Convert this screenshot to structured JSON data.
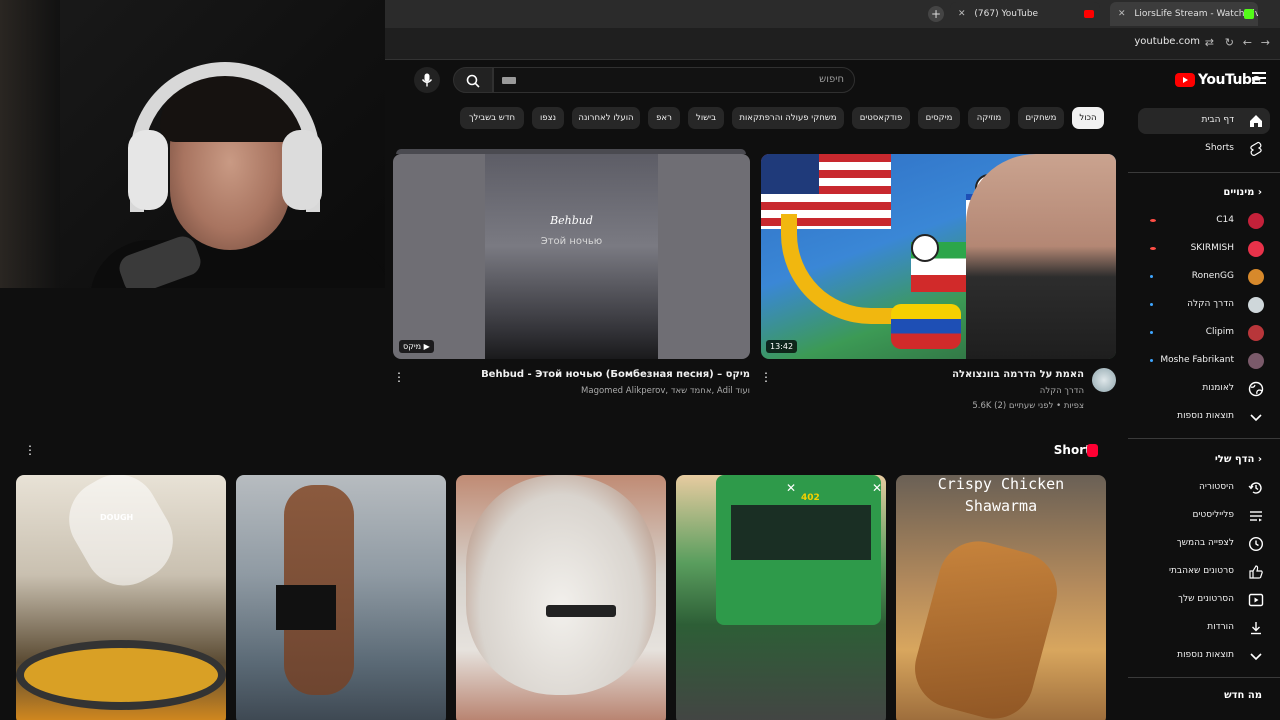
{
  "browser": {
    "tabs": [
      {
        "label": "(767) YouTube"
      },
      {
        "label": "LiorsLife Stream - Watch Live on Kick"
      }
    ],
    "url": "youtube.com"
  },
  "header": {
    "logo_text": "YouTube",
    "search_placeholder": "חיפוש"
  },
  "chips": [
    "הכול",
    "משחקים",
    "מוזיקה",
    "מיקסים",
    "פודקאסטים",
    "משחקי פעולה והרפתקאות",
    "בישול",
    "ראפ",
    "הועלו לאחרונה",
    "נצפו",
    "חדש בשבילך"
  ],
  "sidebar": {
    "home": "דף הבית",
    "shorts": "Shorts",
    "subs_header": "מינויים",
    "subs": [
      {
        "name": "C14",
        "status": "live"
      },
      {
        "name": "SKIRMISH",
        "status": "live"
      },
      {
        "name": "RonenGG",
        "status": "new"
      },
      {
        "name": "הדרך הקלה",
        "status": "new"
      },
      {
        "name": "Clipim",
        "status": "new"
      },
      {
        "name": "Moshe Fabrikant",
        "status": "new"
      },
      {
        "name": "לאומנות",
        "status": "none"
      }
    ],
    "more1": "תוצאות נוספות",
    "you_header": "הדף שלי",
    "you_items": [
      "היסטוריה",
      "פלייליסטים",
      "לצפייה בהמשך",
      "סרטונים שאהבתי",
      "הסרטונים שלך",
      "הורדות"
    ],
    "more2": "תוצאות נוספות",
    "whats_new": "מה חדש"
  },
  "videos": [
    {
      "title": "Behbud - Этой ночью (Бомбезная песня) – מיקס",
      "meta": "Magomed Alikperov, אחמד שאד, Adil ועוד",
      "badge": "מיקס",
      "thumb_title": "Behbud",
      "thumb_sub": "Этой ночью"
    },
    {
      "title": "האמת על הדרמה בוונצואלה",
      "channel": "הדרך הקלה",
      "meta": "5.6K צפיות • לפני שעתיים (2)",
      "duration": "13:42"
    }
  ],
  "shorts": {
    "title": "Shorts",
    "items": [
      {
        "overlay": "DOUGH"
      },
      {
        "overlay": ""
      },
      {
        "overlay": ""
      },
      {
        "overlay": "402"
      },
      {
        "overlay_line1": "Crispy Chicken",
        "overlay_line2": "Shawarma"
      }
    ]
  }
}
